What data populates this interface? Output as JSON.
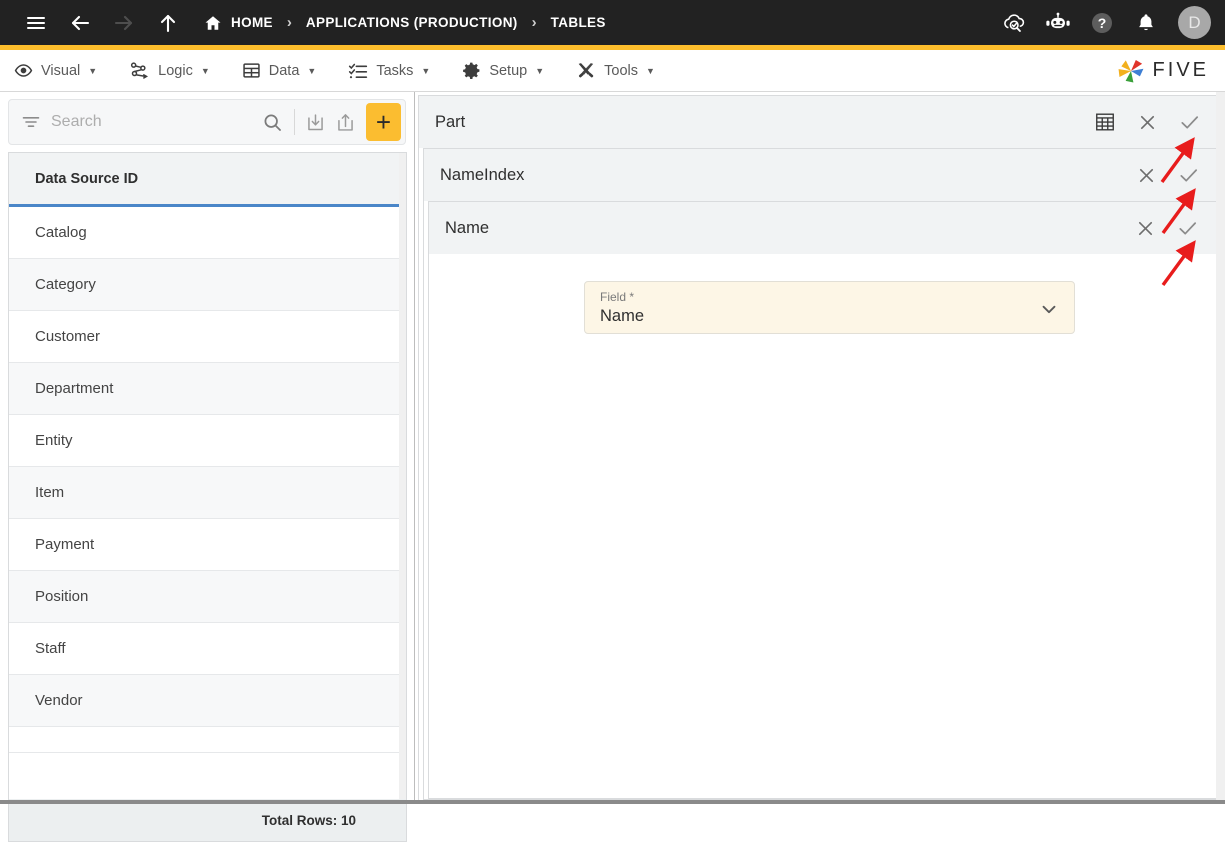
{
  "topbar": {
    "menu_icon": "hamburger-icon",
    "back_icon": "arrow-left-icon",
    "forward_icon": "arrow-right-icon",
    "up_icon": "arrow-up-icon",
    "breadcrumbs": [
      {
        "label": "HOME",
        "icon": "home-icon"
      },
      {
        "label": "APPLICATIONS (PRODUCTION)",
        "icon": ""
      },
      {
        "label": "TABLES",
        "icon": ""
      }
    ],
    "separator": "›",
    "actions": [
      {
        "name": "cloud-check-icon"
      },
      {
        "name": "robot-icon"
      },
      {
        "name": "help-icon"
      },
      {
        "name": "bell-icon"
      }
    ],
    "avatar_initial": "D"
  },
  "menubar": {
    "items": [
      {
        "label": "Visual",
        "icon": "eye-icon"
      },
      {
        "label": "Logic",
        "icon": "flow-nodes-icon"
      },
      {
        "label": "Data",
        "icon": "table-icon"
      },
      {
        "label": "Tasks",
        "icon": "checklist-icon"
      },
      {
        "label": "Setup",
        "icon": "gear-icon"
      },
      {
        "label": "Tools",
        "icon": "tools-icon"
      }
    ],
    "caret": "▼",
    "logo_text": "FIVE"
  },
  "sidebar": {
    "search": {
      "placeholder": "Search",
      "value": ""
    },
    "toolbar": [
      {
        "name": "filter-icon"
      },
      {
        "name": "search-icon"
      },
      {
        "name": "import-icon"
      },
      {
        "name": "export-icon"
      },
      {
        "name": "add-icon",
        "label": "+"
      }
    ],
    "grid": {
      "column_header": "Data Source ID",
      "rows": [
        "Catalog",
        "Category",
        "Customer",
        "Department",
        "Entity",
        "Item",
        "Payment",
        "Position",
        "Staff",
        "Vendor"
      ],
      "total_rows_label": "Total Rows: 10"
    }
  },
  "main": {
    "panels": [
      {
        "title": "Part",
        "has_table_icon": true,
        "close_label": "✕",
        "confirm_label": "✓"
      },
      {
        "title": "NameIndex",
        "has_table_icon": false,
        "close_label": "✕",
        "confirm_label": "✓"
      },
      {
        "title": "Name",
        "has_table_icon": false,
        "close_label": "✕",
        "confirm_label": "✓"
      }
    ],
    "form": {
      "field_label": "Field *",
      "field_value": "Name",
      "chevron": "chevron-down-icon"
    }
  },
  "colors": {
    "topbar_bg": "#222222",
    "accent_yellow": "#fdbe2c",
    "header_blue_underline": "#4a86c8",
    "panel_header_bg": "#f1f3f4",
    "field_bg": "#fdf6e6",
    "annotation_red": "#e81c1c"
  }
}
